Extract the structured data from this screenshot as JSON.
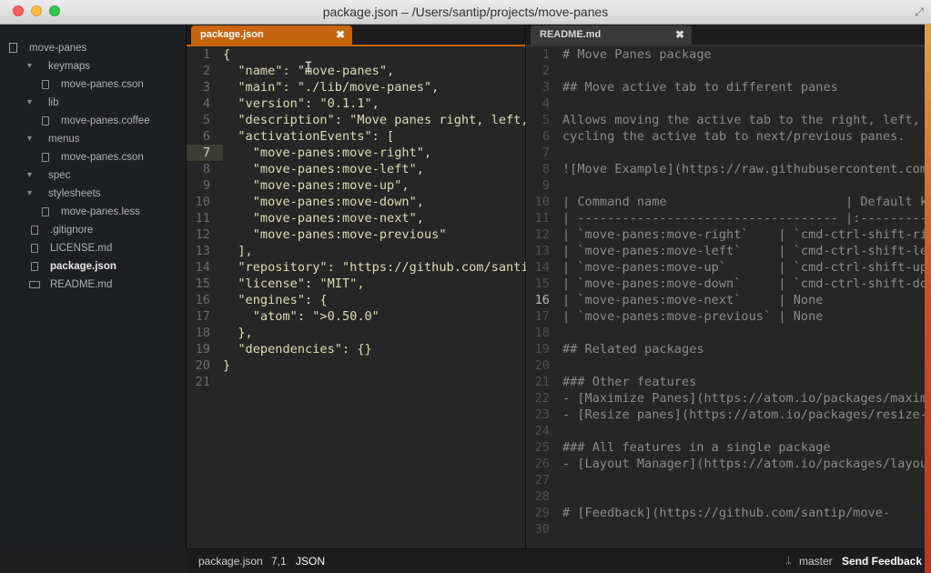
{
  "window": {
    "title": "package.json – /Users/santip/projects/move-panes"
  },
  "sidebar": {
    "items": [
      {
        "label": "move-panes",
        "depth": 0,
        "icon": "repo-icon",
        "active": false
      },
      {
        "label": "keymaps",
        "depth": 1,
        "icon": "folder-icon",
        "active": false
      },
      {
        "label": "move-panes.cson",
        "depth": 2,
        "icon": "file-icon",
        "active": false
      },
      {
        "label": "lib",
        "depth": 1,
        "icon": "folder-icon",
        "active": false
      },
      {
        "label": "move-panes.coffee",
        "depth": 2,
        "icon": "file-icon",
        "active": false
      },
      {
        "label": "menus",
        "depth": 1,
        "icon": "folder-icon",
        "active": false
      },
      {
        "label": "move-panes.cson",
        "depth": 2,
        "icon": "file-icon",
        "active": false
      },
      {
        "label": "spec",
        "depth": 1,
        "icon": "folder-icon",
        "active": false
      },
      {
        "label": "stylesheets",
        "depth": 1,
        "icon": "folder-icon",
        "active": false
      },
      {
        "label": "move-panes.less",
        "depth": 2,
        "icon": "file-icon",
        "active": false
      },
      {
        "label": ".gitignore",
        "depth": 1,
        "icon": "file-icon",
        "active": false
      },
      {
        "label": "LICENSE.md",
        "depth": 1,
        "icon": "file-icon",
        "active": false
      },
      {
        "label": "package.json",
        "depth": 1,
        "icon": "file-icon",
        "active": true
      },
      {
        "label": "README.md",
        "depth": 1,
        "icon": "markdown-icon",
        "active": false
      }
    ]
  },
  "left_pane": {
    "tab_label": "package.json",
    "close_glyph": "✖",
    "current_line": 7,
    "lines": [
      "{",
      "  \"name\": \"move-panes\",",
      "  \"main\": \"./lib/move-panes\",",
      "  \"version\": \"0.1.1\",",
      "  \"description\": \"Move panes right, left,",
      "  \"activationEvents\": [",
      "    \"move-panes:move-right\",",
      "    \"move-panes:move-left\",",
      "    \"move-panes:move-up\",",
      "    \"move-panes:move-down\",",
      "    \"move-panes:move-next\",",
      "    \"move-panes:move-previous\"",
      "  ],",
      "  \"repository\": \"https://github.com/santip",
      "  \"license\": \"MIT\",",
      "  \"engines\": {",
      "    \"atom\": \">0.50.0\"",
      "  },",
      "  \"dependencies\": {}",
      "}",
      ""
    ]
  },
  "right_pane": {
    "tab_label": "README.md",
    "close_glyph": "✖",
    "current_line": 16,
    "lines": [
      "# Move Panes package",
      "",
      "## Move active tab to different panes",
      "",
      "Allows moving the active tab to the right, left, u",
      "cycling the active tab to next/previous panes.",
      "",
      "![Move Example](https://raw.githubusercontent.com/",
      "",
      "| Command name                        | Default ke",
      "| ----------------------------------- |:----------",
      "| `move-panes:move-right`    | `cmd-ctrl-shift-rig",
      "| `move-panes:move-left`     | `cmd-ctrl-shift-lef",
      "| `move-panes:move-up`       | `cmd-ctrl-shift-up`",
      "| `move-panes:move-down`     | `cmd-ctrl-shift-dow",
      "| `move-panes:move-next`     | None",
      "| `move-panes:move-previous` | None",
      "",
      "## Related packages",
      "",
      "### Other features",
      "- [Maximize Panes](https://atom.io/packages/maximi",
      "- [Resize panes](https://atom.io/packages/resize-p",
      "",
      "### All features in a single package",
      "- [Layout Manager](https://atom.io/packages/layout",
      "",
      "",
      "# [Feedback](https://github.com/santip/move-",
      ""
    ]
  },
  "status_bar": {
    "file": "package.json",
    "cursor": "7,1",
    "grammar": "JSON",
    "branch_icon": "ᛦ",
    "branch": "master",
    "feedback": "Send Feedback"
  },
  "colors": {
    "accent_tab": "#c8630e",
    "background": "#262626",
    "sidebar": "#1e1f22"
  }
}
